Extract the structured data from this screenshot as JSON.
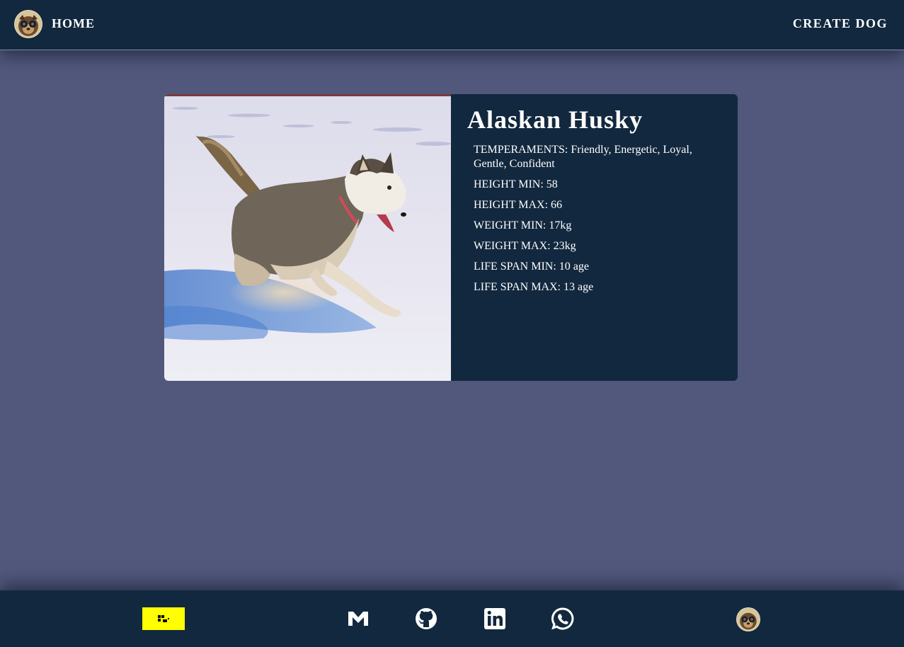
{
  "nav": {
    "home_label": "HOME",
    "create_label": "CREATE DOG",
    "logo_icon": "dog-logo-icon"
  },
  "dog": {
    "name": "Alaskan Husky",
    "image_icon": "husky-photo",
    "attributes": [
      "TEMPERAMENTS: Friendly, Energetic, Loyal, Gentle, Confident",
      "HEIGHT MIN: 58",
      "HEIGHT MAX: 66",
      "WEIGHT MIN: 17kg",
      "WEIGHT MAX: 23kg",
      "LIFE SPAN MIN: 10 age",
      "LIFE SPAN MAX: 13 age"
    ]
  },
  "footer": {
    "badge_icon": "portfolio-badge-icon",
    "social": [
      "gmail-icon",
      "github-icon",
      "linkedin-icon",
      "whatsapp-icon"
    ],
    "avatar_icon": "dog-avatar-icon"
  },
  "colors": {
    "page_bg": "#51587b",
    "bar_bg": "#12283e",
    "card_bg": "#12283e",
    "badge_bg": "#ffff00",
    "text": "#ffffff"
  }
}
